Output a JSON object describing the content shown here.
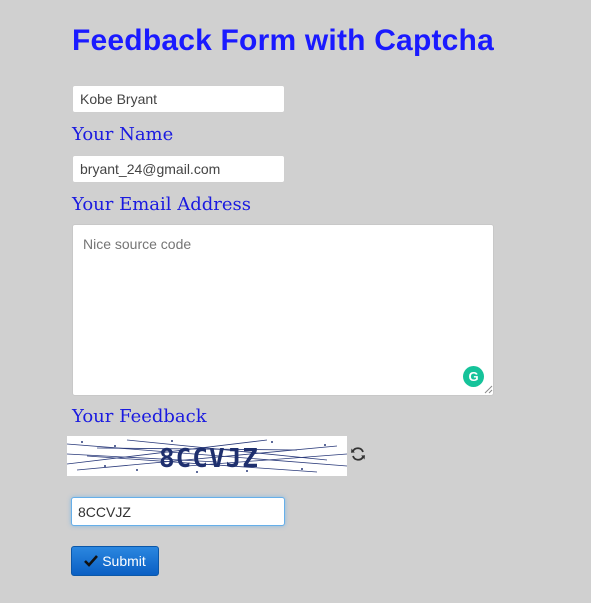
{
  "page": {
    "title": "Feedback Form with Captcha"
  },
  "form": {
    "name_value": "Kobe Bryant",
    "name_label": "Your Name",
    "email_value": "bryant_24@gmail.com",
    "email_label": "Your Email Address",
    "feedback_placeholder": "Nice source code",
    "feedback_label": "Your Feedback",
    "captcha_text": "8CCVJZ",
    "captcha_value": "8CCVJZ",
    "submit_label": "Submit"
  },
  "icons": {
    "grammarly": "grammarly-icon",
    "refresh": "refresh-icon",
    "submit": "checkmark-icon"
  },
  "colors": {
    "background": "#d0d0d0",
    "title": "#1a1aff",
    "label": "#1a1ae0",
    "submit": "#1a6fd6",
    "grammarly": "#15c39a"
  }
}
